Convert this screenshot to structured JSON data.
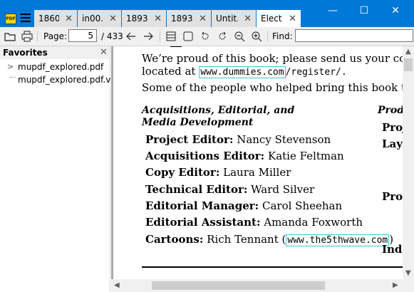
{
  "app": {
    "icon_text": "PDF"
  },
  "tabs": [
    {
      "label": "1860..."
    },
    {
      "label": "in00..."
    },
    {
      "label": "1893..."
    },
    {
      "label": "1893..."
    },
    {
      "label": "Untit..."
    },
    {
      "label": "Elect..."
    }
  ],
  "window_controls": {
    "minimize": "—",
    "maximize": "☐",
    "close": "✕"
  },
  "toolbar": {
    "page_label": "Page:",
    "page_value": "5",
    "page_total": "/ 433",
    "find_label": "Find:",
    "find_value": ""
  },
  "sidebar": {
    "title": "Favorites",
    "items": [
      {
        "label": "mupdf_explored.pdf"
      },
      {
        "label": "mupdf_explored.pdf.vbkm"
      }
    ]
  },
  "document": {
    "line1_text": "We’re proud of this book; please send us your comments t",
    "line2_pre": "located at ",
    "line2_link": "www.dummies.com",
    "line2_post": "/register/.",
    "line3_text": "Some of the people who helped bring this book to marke",
    "section_heading_1": "Acquisitions, Editorial, and",
    "section_heading_2": "Media Development",
    "credits": [
      {
        "role": "Project Editor:",
        "name": " Nancy Stevenson"
      },
      {
        "role": "Acquisitions Editor:",
        "name": " Katie Feltman"
      },
      {
        "role": "Copy Editor:",
        "name": " Laura Miller"
      },
      {
        "role": "Technical Editor:",
        "name": " Ward Silver"
      },
      {
        "role": "Editorial Manager:",
        "name": " Carol Sheehan"
      },
      {
        "role": "Editorial Assistant:",
        "name": " Amanda Foxworth"
      }
    ],
    "cartoons_role": "Cartoons:",
    "cartoons_name": " Rich Tennant (",
    "cartoons_link": "www.the5thwave.com",
    "cartoons_close": ")",
    "right_col": [
      "Prod",
      "Proj",
      "Layo",
      "Proo",
      "Inde"
    ]
  },
  "colors": {
    "titlebar": "#0078d7",
    "link_border": "#3fc0e0",
    "doc_bg": "#a9a9a9"
  }
}
